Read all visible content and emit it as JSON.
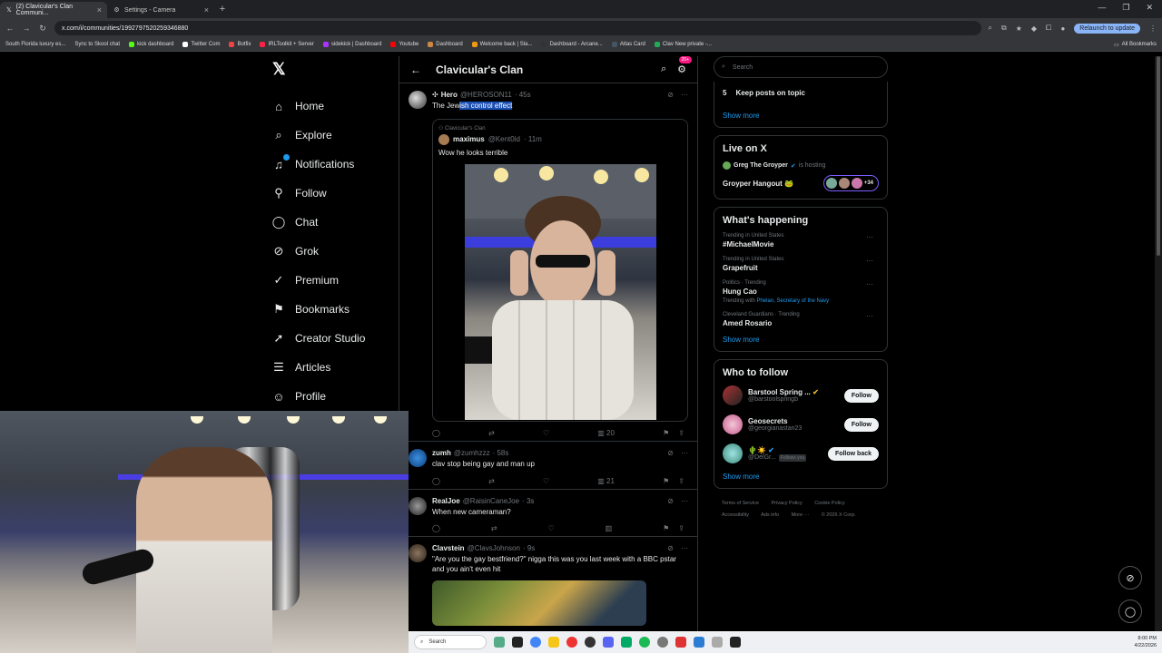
{
  "browser": {
    "tabs": [
      {
        "label": "(2) Clavicular's Clan Communi...",
        "icon": "x-logo-icon",
        "active": true
      },
      {
        "label": "Settings - Camera",
        "icon": "gear-icon",
        "active": false
      }
    ],
    "url": "x.com/i/communities/1992797520259346880",
    "relaunch_label": "Relaunch to update",
    "bookmarks": [
      "South Florida luxury es...",
      "Sync to Skool chat",
      "kick dashboard",
      "Twitter Com",
      "Botfix",
      "IRLToolkit + Server",
      "sidekick | Dashboard",
      "Youtube",
      "Dashboard",
      "Welcome back | Sla...",
      "Dashboard - Arcane...",
      "Atlas Card",
      "Clav New private -..."
    ],
    "all_bookmarks_label": "All Bookmarks"
  },
  "nav": {
    "items": [
      {
        "label": "Home",
        "icon": "home-icon"
      },
      {
        "label": "Explore",
        "icon": "search-icon"
      },
      {
        "label": "Notifications",
        "icon": "bell-icon"
      },
      {
        "label": "Follow",
        "icon": "follow-icon"
      },
      {
        "label": "Chat",
        "icon": "chat-icon"
      },
      {
        "label": "Grok",
        "icon": "grok-icon"
      },
      {
        "label": "Premium",
        "icon": "premium-icon"
      },
      {
        "label": "Bookmarks",
        "icon": "bookmark-icon"
      },
      {
        "label": "Creator Studio",
        "icon": "rocket-icon"
      },
      {
        "label": "Articles",
        "icon": "article-icon"
      },
      {
        "label": "Profile",
        "icon": "profile-icon"
      }
    ],
    "notif_count": "2"
  },
  "main": {
    "title": "Clavicular's Clan",
    "badge": "20+",
    "posts": [
      {
        "name": "Hero",
        "handle": "@HEROSON11",
        "time": "· 45s",
        "text_pre": "The Jew",
        "text_hl": "ish control effect",
        "quote": {
          "community": "Clavicular's Clan",
          "name": "maximus",
          "handle": "@Kent0id",
          "time": "· 11m",
          "text": "Wow he looks terrible"
        },
        "views": "20"
      },
      {
        "name": "zumh",
        "handle": "@zumhzzz",
        "time": "· 58s",
        "text": "clav stop being gay and man up",
        "views": "21"
      },
      {
        "name": "RealJoe",
        "handle": "@RaisinCaneJoe",
        "time": "· 3s",
        "text": "When new cameraman?",
        "views": ""
      },
      {
        "name": "Clavstein",
        "handle": "@ClavsJohnson",
        "time": "· 9s",
        "text": "\"Are you the gay bestfriend?\" nigga this was you last week with a BBC pstar and you ain't even hit"
      }
    ]
  },
  "right": {
    "search_placeholder": "Search",
    "topic": {
      "num": "5",
      "label": "Keep posts on topic",
      "show_more": "Show more"
    },
    "live": {
      "title": "Live on X",
      "host": "Greg The Groyper",
      "hosting": "is hosting",
      "space": "Groyper Hangout 🐸",
      "count": "+34"
    },
    "happening": {
      "title": "What's happening",
      "trends": [
        {
          "meta": "Trending in United States",
          "name": "#MichaelMovie",
          "with": ""
        },
        {
          "meta": "Trending in United States",
          "name": "Grapefruit",
          "with": ""
        },
        {
          "meta": "Politics · Trending",
          "name": "Hung Cao",
          "with_pre": "Trending with",
          "with": "Phelan, Secretary of the Navy"
        },
        {
          "meta": "Cleveland Guardians · Trending",
          "name": "Amed Rosario",
          "with": ""
        }
      ],
      "show_more": "Show more"
    },
    "wtf": {
      "title": "Who to follow",
      "users": [
        {
          "name": "Barstool Spring ...",
          "handle": "@barstoolspringb",
          "btn": "Follow"
        },
        {
          "name": "Geosecrets",
          "handle": "@georgianastan23",
          "btn": "Follow"
        },
        {
          "name": "🌵☀️",
          "handle": "@DelGr...",
          "follows_you": "Follows you",
          "btn": "Follow back"
        }
      ],
      "show_more": "Show more"
    },
    "footer": [
      "Terms of Service",
      "Privacy Policy",
      "Cookie Policy",
      "Accessibility",
      "Ads info",
      "More ···",
      "© 2026 X Corp."
    ]
  },
  "taskbar": {
    "search_placeholder": "Search",
    "time": "8:00 PM",
    "date": "4/22/2026"
  },
  "colors": {
    "accent": "#1d9bf0",
    "highlight": "#1a4fb5",
    "badge": "#f91880"
  }
}
